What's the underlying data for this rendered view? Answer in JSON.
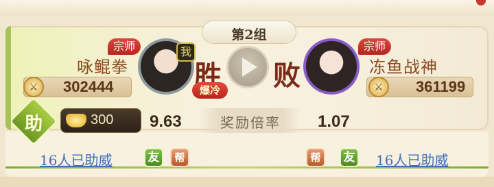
{
  "group": {
    "label": "第2组"
  },
  "left_player": {
    "rank": "宗师",
    "name": "咏鲲拳",
    "power": "302444",
    "me_badge": "我",
    "result": "胜",
    "tag": "爆冷"
  },
  "right_player": {
    "rank": "宗师",
    "name": "冻鱼战神",
    "power": "361199",
    "result": "败"
  },
  "bet": {
    "help_char": "助",
    "amount": "300",
    "left_odds": "9.63",
    "odds_label": "奖励倍率",
    "right_odds": "1.07"
  },
  "support": {
    "left_link": "16人已助威",
    "right_link": "16人已助威",
    "friend_tag": "友",
    "guild_tag": "帮"
  },
  "icons": {
    "play": "play-icon",
    "power": "sword-medal-icon",
    "gold": "gold-ingot-icon"
  },
  "colors": {
    "win_red": "#b4281f",
    "help_green": "#6c9722",
    "link_blue": "#3d6fb8"
  }
}
